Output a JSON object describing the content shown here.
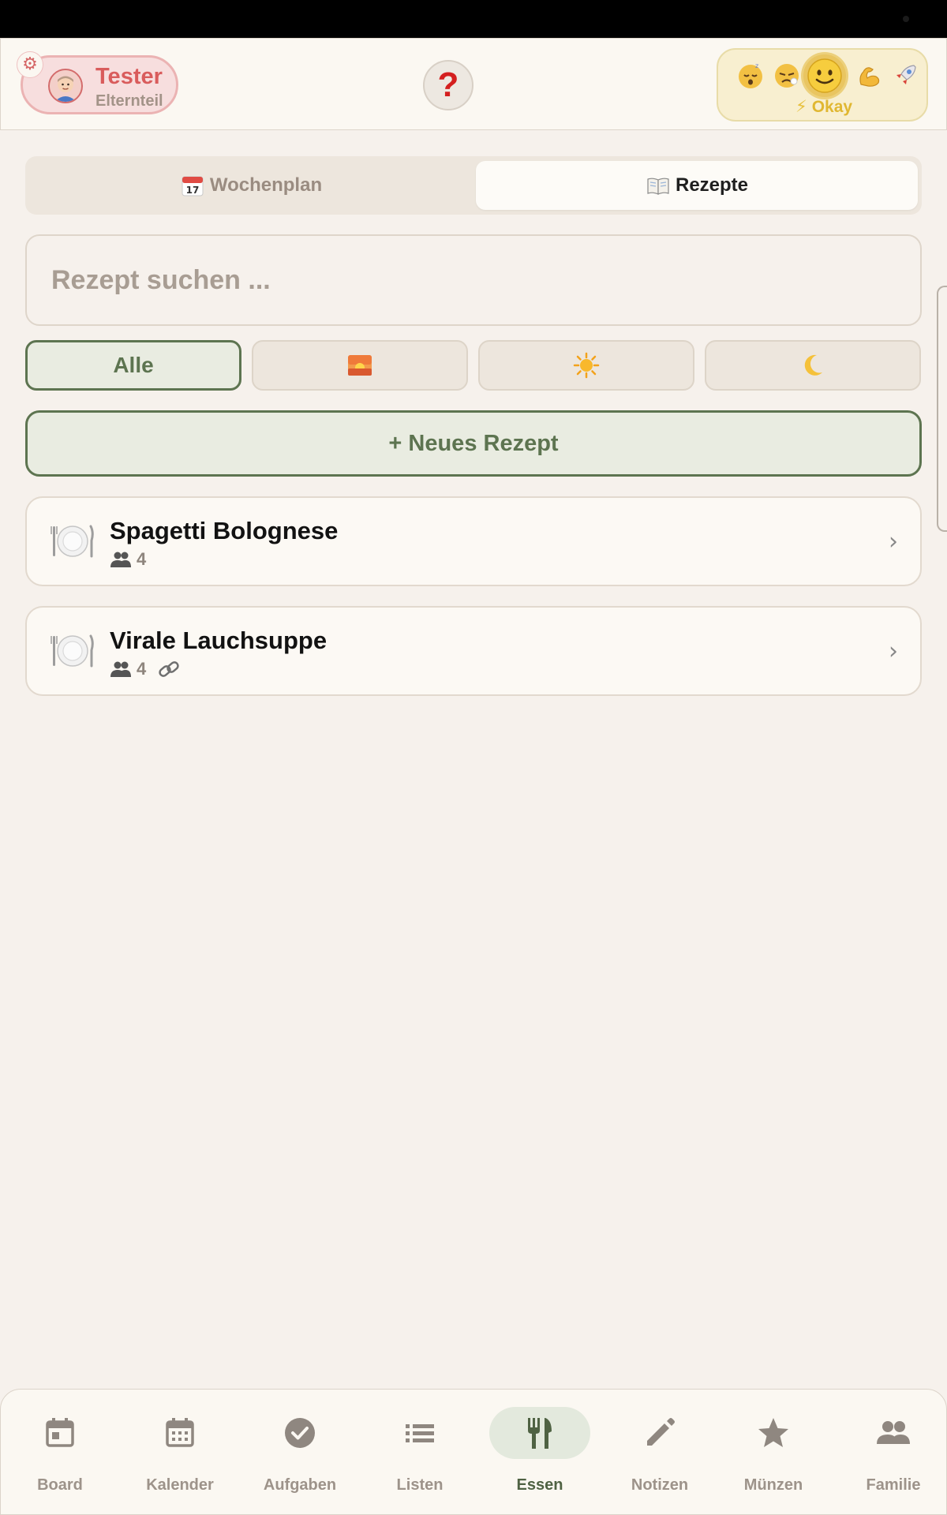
{
  "header": {
    "profile": {
      "name": "Tester",
      "role": "Elternteil"
    },
    "help_label": "?",
    "mood": {
      "options": [
        "sleepy-face",
        "tired-face",
        "slightly-smiling-face",
        "flexed-biceps",
        "rocket"
      ],
      "selected": "slightly-smiling-face",
      "selected_label": "Okay"
    }
  },
  "tabs": [
    {
      "label": "Wochenplan",
      "icon": "calendar-emoji",
      "active": false
    },
    {
      "label": "Rezepte",
      "icon": "open-book-emoji",
      "active": true
    }
  ],
  "search": {
    "placeholder": "Rezept suchen ..."
  },
  "filters": [
    {
      "label": "Alle",
      "active": true
    },
    {
      "icon": "sunrise-emoji",
      "active": false
    },
    {
      "icon": "sun-emoji",
      "active": false
    },
    {
      "icon": "crescent-moon-emoji",
      "active": false
    }
  ],
  "new_recipe_label": "+ Neues Rezept",
  "recipes": [
    {
      "title": "Spagetti Bolognese",
      "servings": "4",
      "has_link": false
    },
    {
      "title": "Virale Lauchsuppe",
      "servings": "4",
      "has_link": true
    }
  ],
  "nav": {
    "items": [
      {
        "label": "Board",
        "icon": "calendar-today-icon"
      },
      {
        "label": "Kalender",
        "icon": "calendar-month-icon"
      },
      {
        "label": "Aufgaben",
        "icon": "check-circle-icon"
      },
      {
        "label": "Listen",
        "icon": "list-icon"
      },
      {
        "label": "Essen",
        "icon": "restaurant-icon"
      },
      {
        "label": "Notizen",
        "icon": "pencil-icon"
      },
      {
        "label": "Münzen",
        "icon": "star-icon"
      },
      {
        "label": "Familie",
        "icon": "people-icon"
      }
    ],
    "active": "Essen"
  },
  "colors": {
    "background": "#f6f1ec",
    "accent_green": "#5d7450",
    "profile_red": "#d95c5c",
    "mood_yellow": "#e0b731",
    "help_red": "#d41f1f"
  }
}
